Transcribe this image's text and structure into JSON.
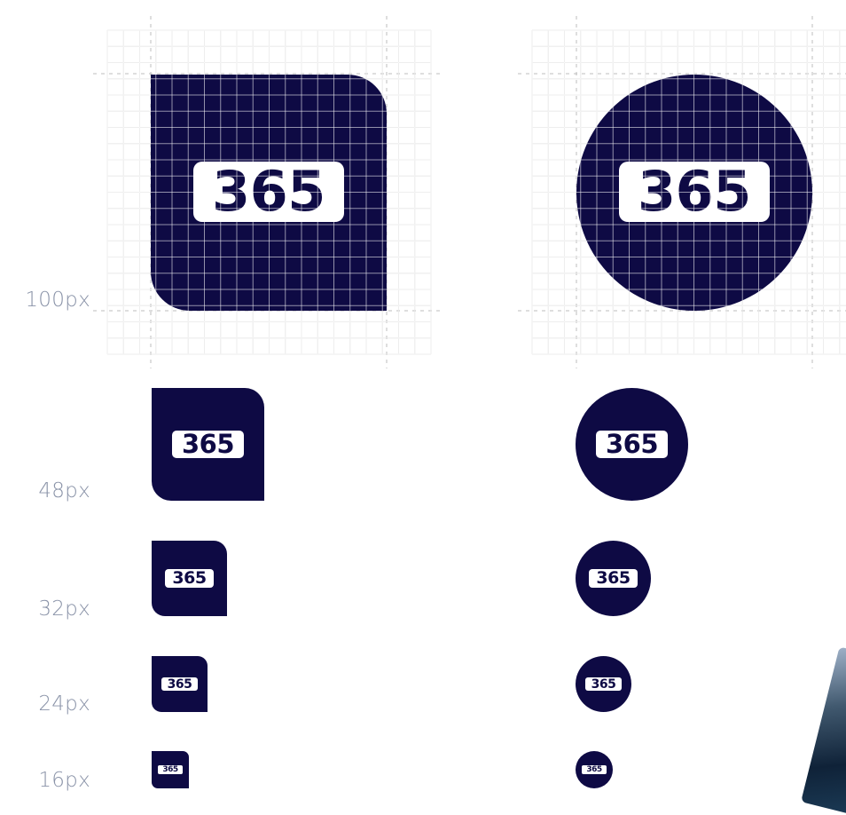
{
  "badge_text": "365",
  "colors": {
    "brand": "#0e0a44",
    "badge": "#ffffff",
    "grid": "#d6d6d6",
    "label": "#8a93a8"
  },
  "sizes": [
    {
      "label": "100px"
    },
    {
      "label": "48px"
    },
    {
      "label": "32px"
    },
    {
      "label": "24px"
    },
    {
      "label": "16px"
    }
  ],
  "shapes": [
    "rounded-square",
    "circle"
  ]
}
